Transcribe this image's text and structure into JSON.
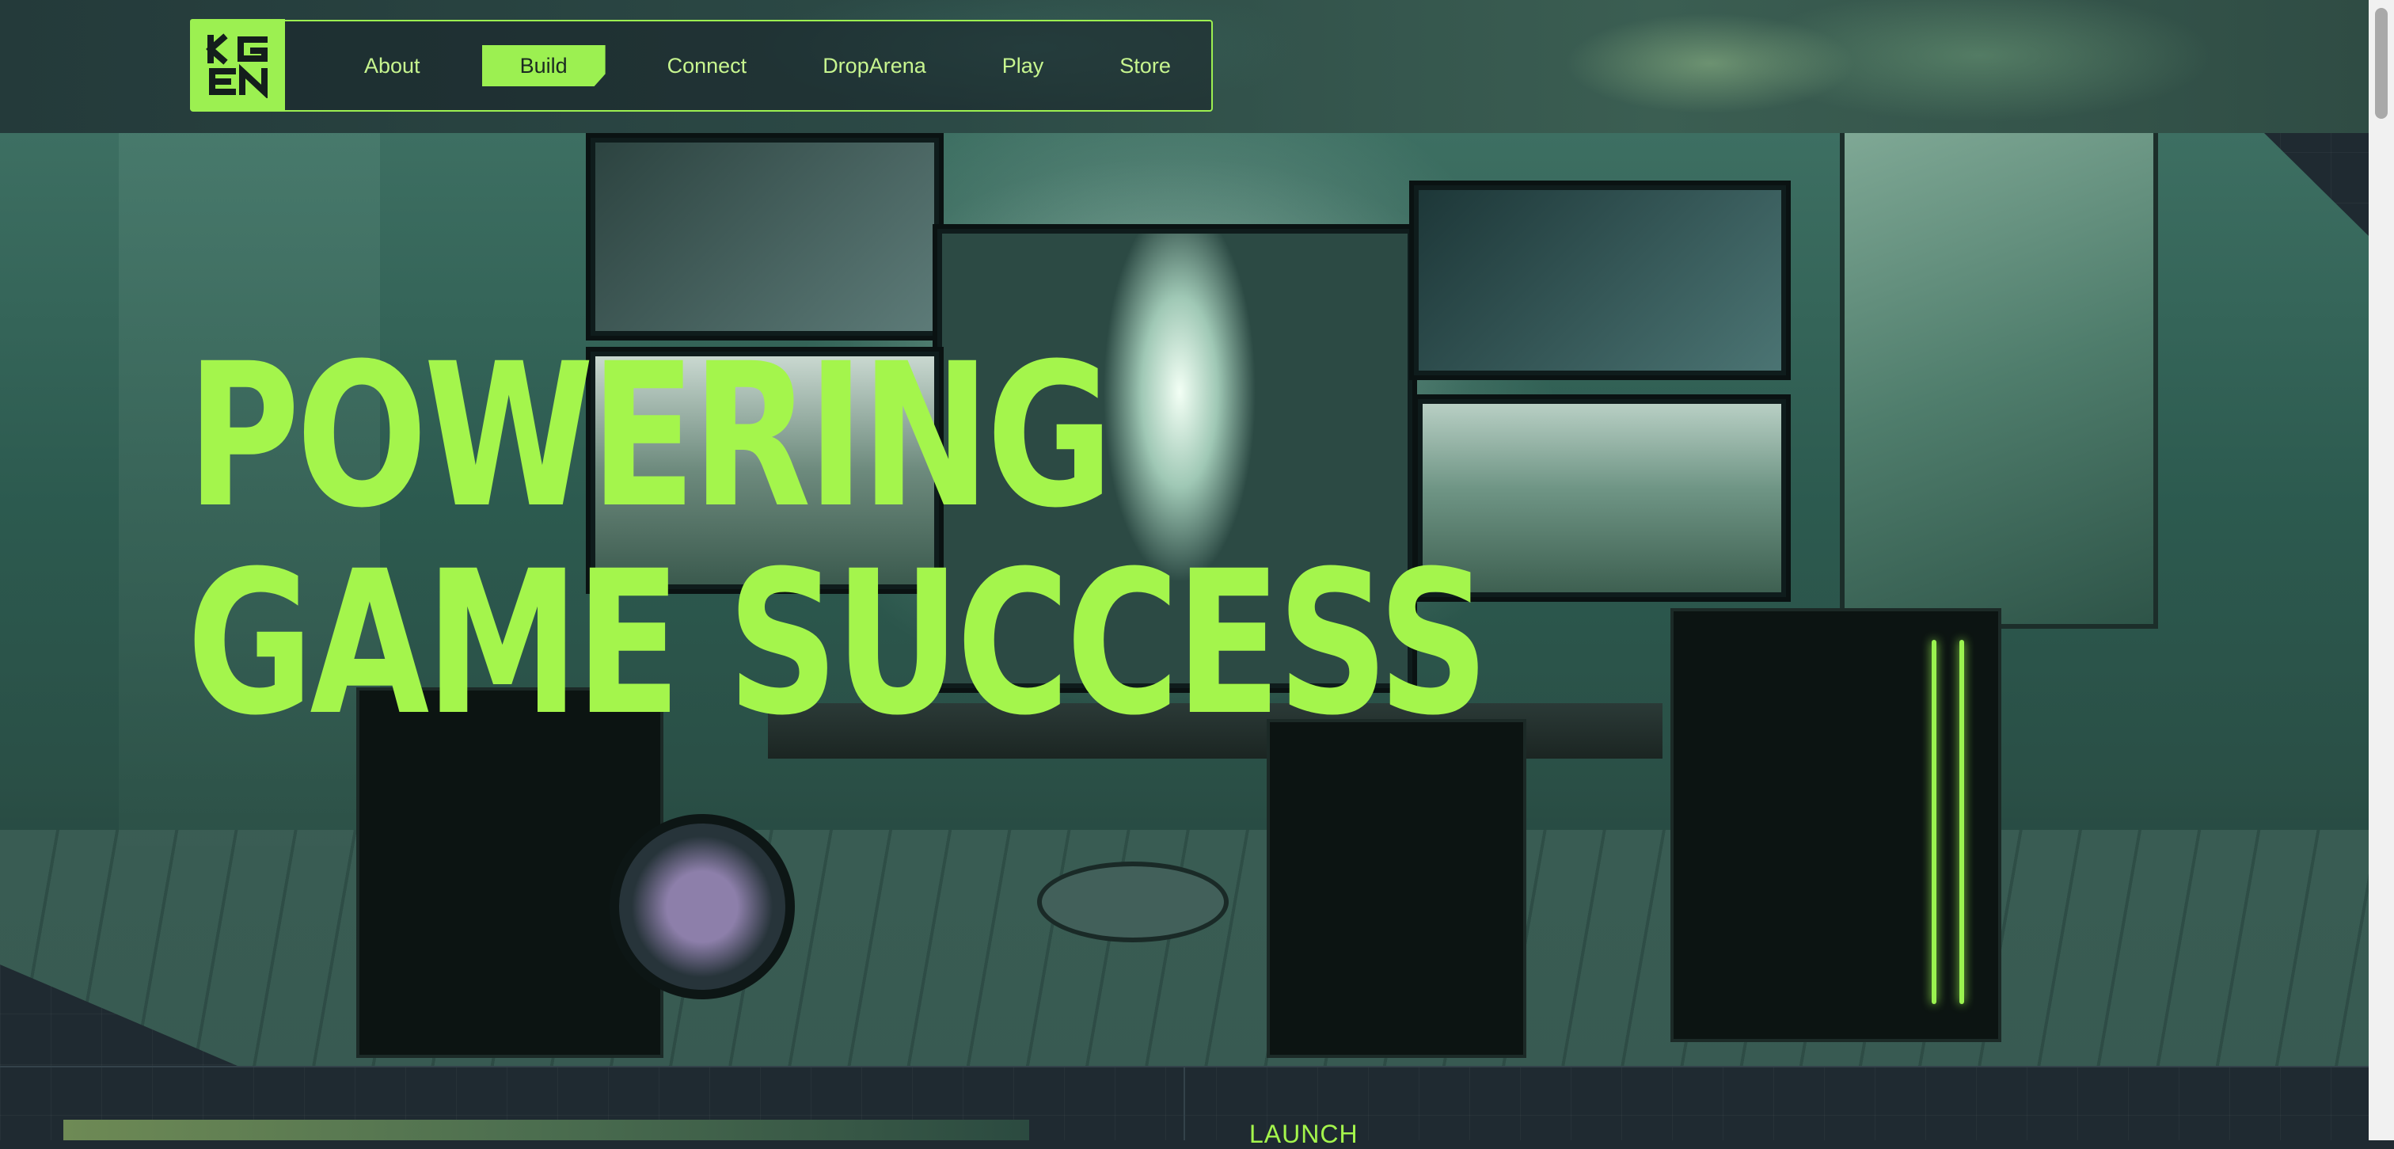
{
  "nav": {
    "logo_text": "KGEN",
    "items": [
      {
        "label": "About"
      },
      {
        "label": "Build"
      },
      {
        "label": "Connect"
      },
      {
        "label": "DropArena"
      },
      {
        "label": "Play"
      },
      {
        "label": "Store"
      }
    ],
    "active_item": "Build"
  },
  "hero": {
    "headline_line1": "POWERING",
    "headline_line2": "GAME SUCCESS"
  },
  "section": {
    "launch_label": "LAUNCH"
  },
  "colors": {
    "accent": "#9cf051",
    "background": "#1f2a31"
  }
}
